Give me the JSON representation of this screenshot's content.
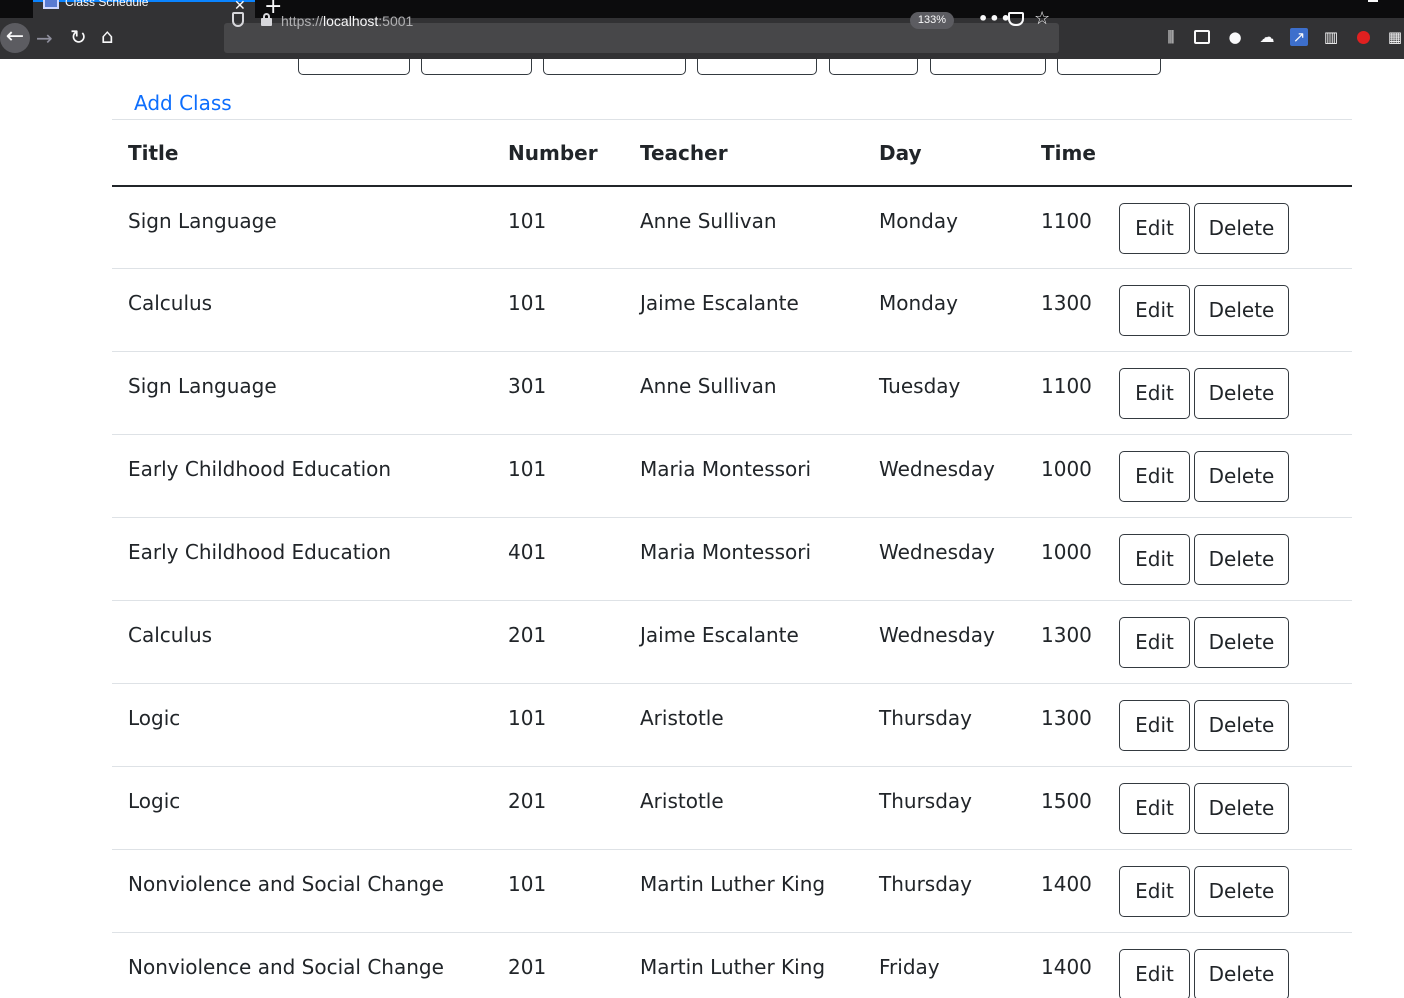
{
  "browser": {
    "tab_title": "Class Schedule",
    "url_scheme": "https://",
    "url_host": "localhost",
    "url_port": ":5001",
    "zoom": "133%"
  },
  "page": {
    "add_class_label": "Add Class",
    "columns": [
      "Title",
      "Number",
      "Teacher",
      "Day",
      "Time"
    ],
    "edit_label": "Edit",
    "delete_label": "Delete",
    "rows": [
      {
        "title": "Sign Language",
        "number": "101",
        "teacher": "Anne Sullivan",
        "day": "Monday",
        "time": "1100"
      },
      {
        "title": "Calculus",
        "number": "101",
        "teacher": "Jaime Escalante",
        "day": "Monday",
        "time": "1300"
      },
      {
        "title": "Sign Language",
        "number": "301",
        "teacher": "Anne Sullivan",
        "day": "Tuesday",
        "time": "1100"
      },
      {
        "title": "Early Childhood Education",
        "number": "101",
        "teacher": "Maria Montessori",
        "day": "Wednesday",
        "time": "1000"
      },
      {
        "title": "Early Childhood Education",
        "number": "401",
        "teacher": "Maria Montessori",
        "day": "Wednesday",
        "time": "1000"
      },
      {
        "title": "Calculus",
        "number": "201",
        "teacher": "Jaime Escalante",
        "day": "Wednesday",
        "time": "1300"
      },
      {
        "title": "Logic",
        "number": "101",
        "teacher": "Aristotle",
        "day": "Thursday",
        "time": "1300"
      },
      {
        "title": "Logic",
        "number": "201",
        "teacher": "Aristotle",
        "day": "Thursday",
        "time": "1500"
      },
      {
        "title": "Nonviolence and Social Change",
        "number": "101",
        "teacher": "Martin Luther King",
        "day": "Thursday",
        "time": "1400"
      },
      {
        "title": "Nonviolence and Social Change",
        "number": "201",
        "teacher": "Martin Luther King",
        "day": "Friday",
        "time": "1400"
      }
    ]
  }
}
